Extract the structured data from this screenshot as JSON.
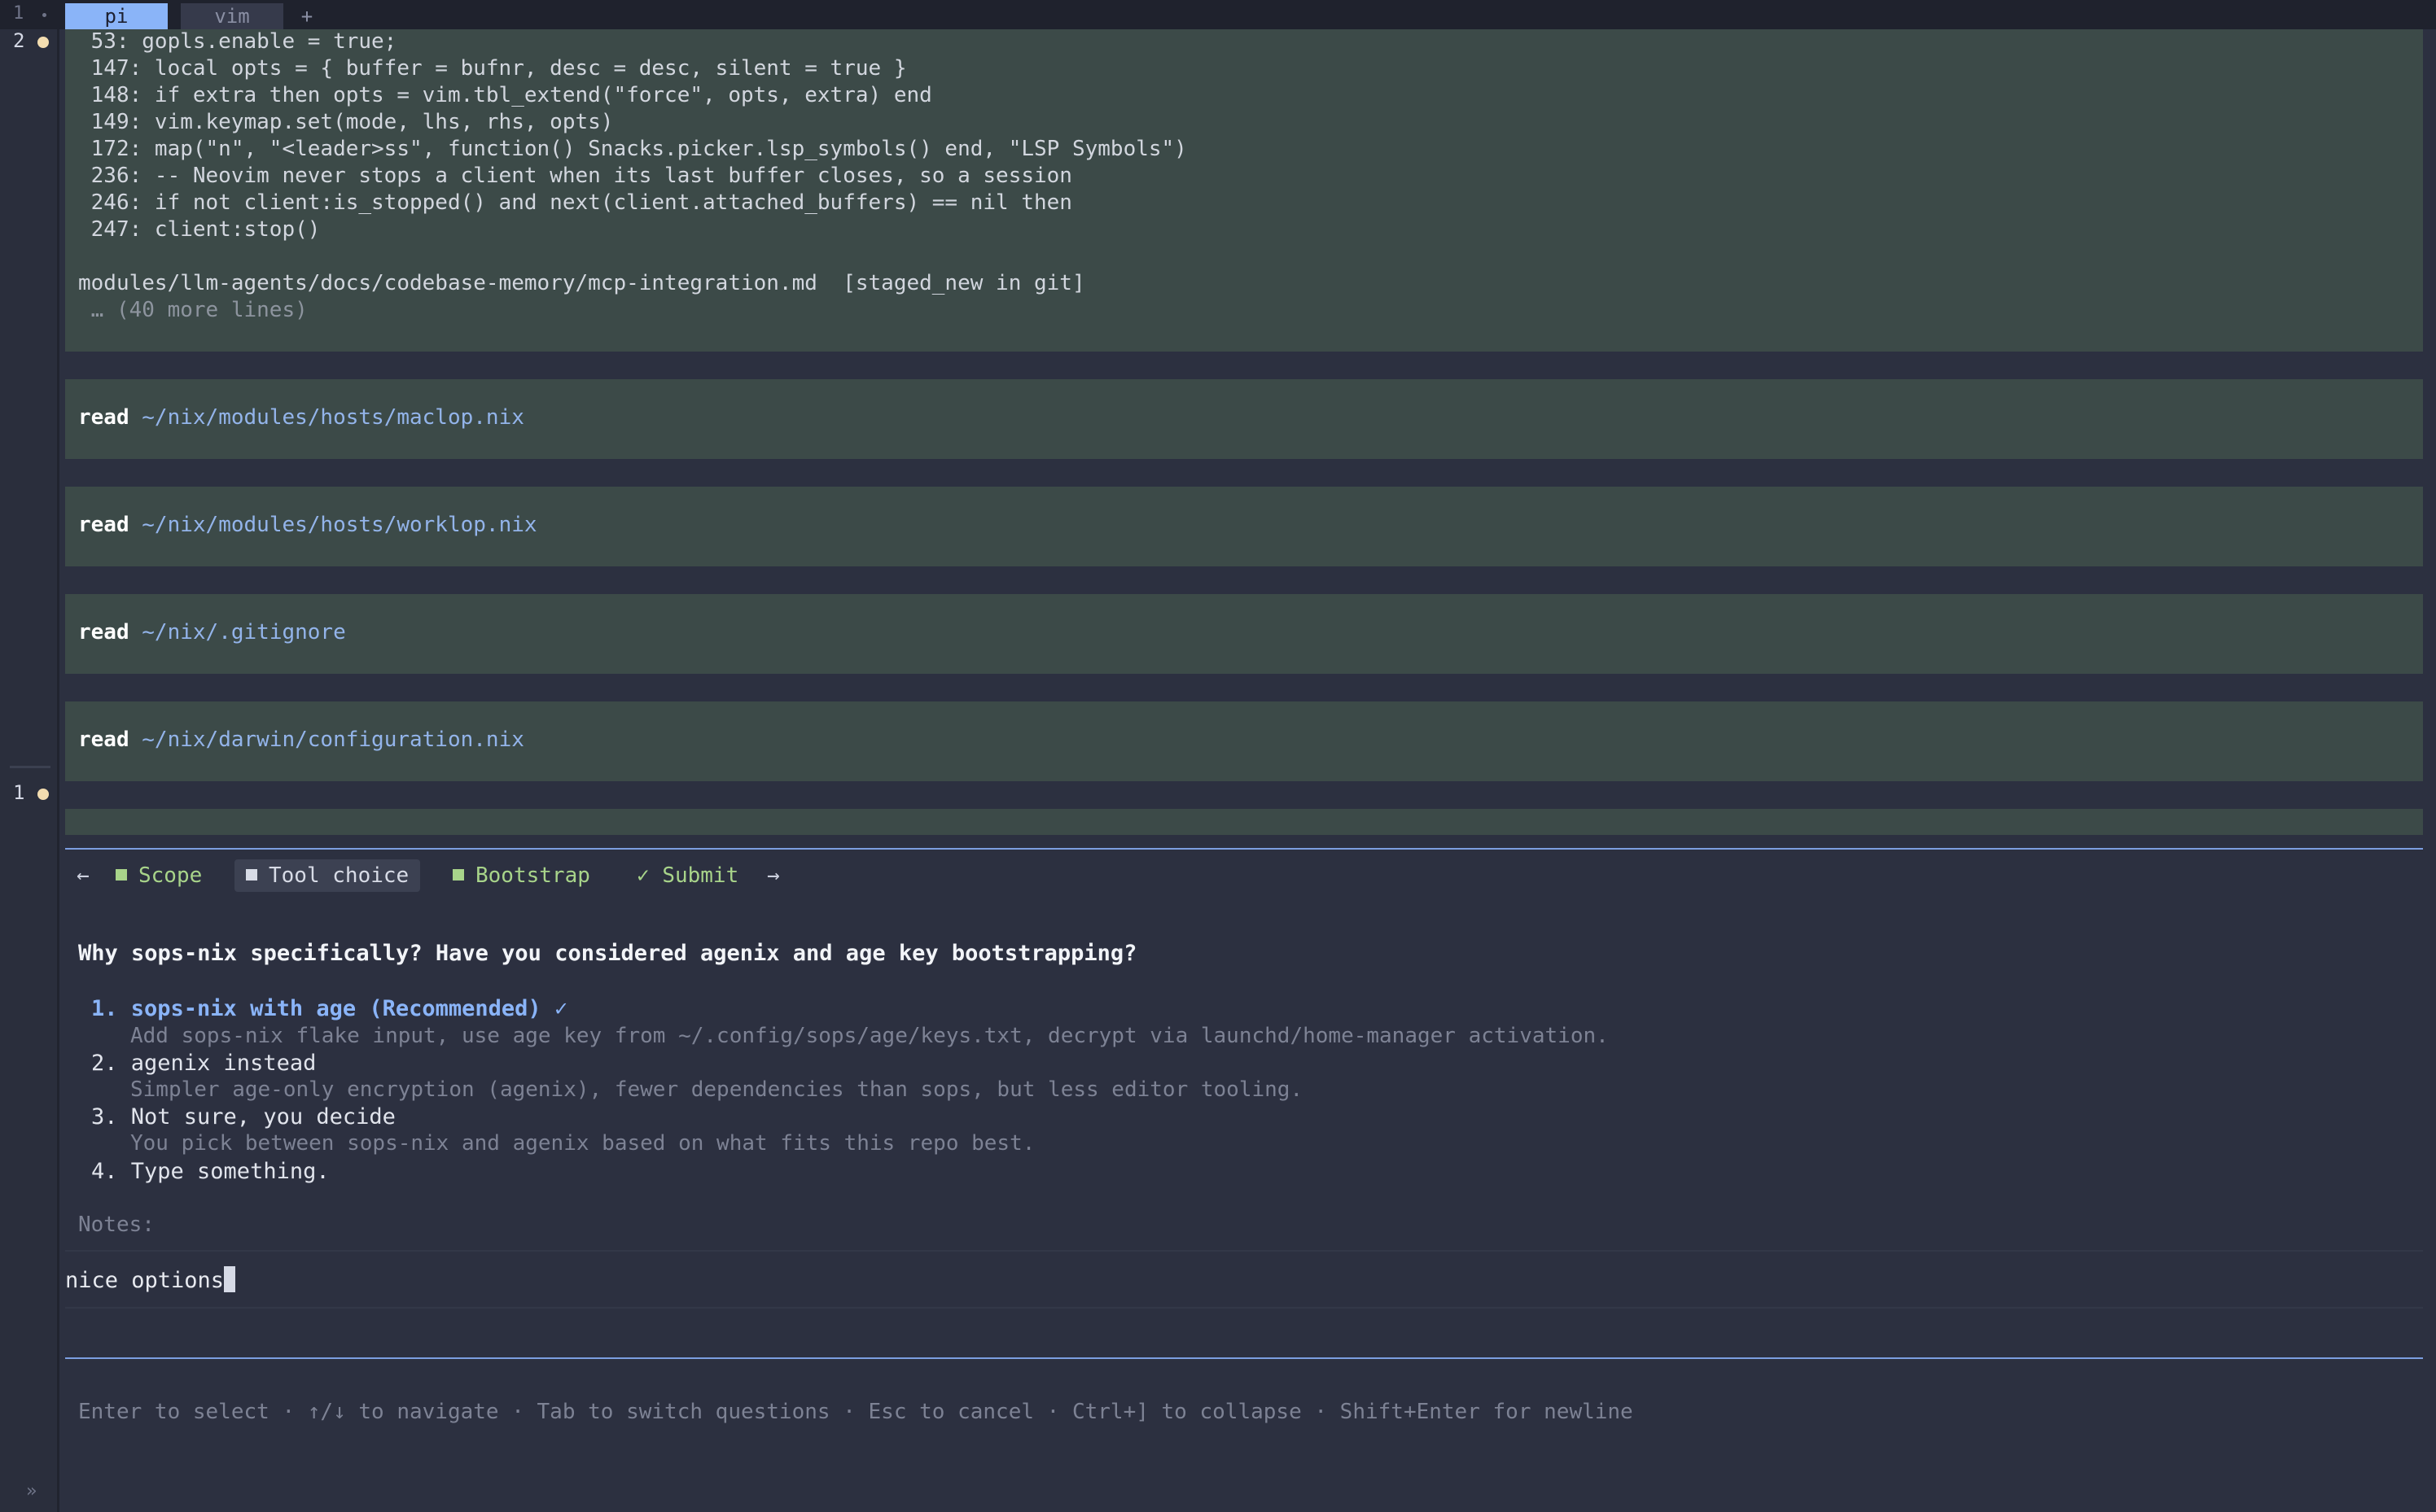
{
  "tabbar": {
    "index": "1",
    "tabs": [
      {
        "label": "pi",
        "active": true
      },
      {
        "label": "vim",
        "active": false
      }
    ],
    "new_tab": "+"
  },
  "gutter": {
    "panes": [
      {
        "number": "2"
      },
      {
        "number": "1"
      }
    ]
  },
  "output": {
    "grep_lines": [
      " 53: gopls.enable = true;",
      " 147: local opts = { buffer = bufnr, desc = desc, silent = true }",
      " 148: if extra then opts = vim.tbl_extend(\"force\", opts, extra) end",
      " 149: vim.keymap.set(mode, lhs, rhs, opts)",
      " 172: map(\"n\", \"<leader>ss\", function() Snacks.picker.lsp_symbols() end, \"LSP Symbols\")",
      " 236: -- Neovim never stops a client when its last buffer closes, so a session",
      " 246: if not client:is_stopped() and next(client.attached_buffers) == nil then",
      " 247: client:stop()"
    ],
    "file_line": "modules/llm-agents/docs/codebase-memory/mcp-integration.md  [staged_new in git]",
    "more_lines": " … (40 more lines)",
    "reads": [
      {
        "keyword": "read",
        "path": "~/nix/modules/hosts/maclop.nix"
      },
      {
        "keyword": "read",
        "path": "~/nix/modules/hosts/worklop.nix"
      },
      {
        "keyword": "read",
        "path": "~/nix/.gitignore"
      },
      {
        "keyword": "read",
        "path": "~/nix/darwin/configuration.nix"
      }
    ]
  },
  "wizard": {
    "prev_arrow": "←",
    "next_arrow": "→",
    "steps": [
      {
        "label": "Scope",
        "state": "done"
      },
      {
        "label": "Tool choice",
        "state": "current"
      },
      {
        "label": "Bootstrap",
        "state": "done"
      },
      {
        "label": "Submit",
        "state": "check",
        "mark": "✓"
      }
    ],
    "question": "Why sops-nix specifically? Have you considered agenix and age key bootstrapping?",
    "options": [
      {
        "label": "1. sops-nix with age (Recommended) ✓",
        "desc": "Add sops-nix flake input, use age key from ~/.config/sops/age/keys.txt, decrypt via launchd/home-manager activation.",
        "selected": true
      },
      {
        "label": "2. agenix instead",
        "desc": "Simpler age-only encryption (agenix), fewer dependencies than sops, but less editor tooling.",
        "selected": false
      },
      {
        "label": "3. Not sure, you decide",
        "desc": "You pick between sops-nix and agenix based on what fits this repo best.",
        "selected": false
      },
      {
        "label": "4. Type something.",
        "desc": "",
        "selected": false
      }
    ],
    "notes_label": "Notes:",
    "notes_value": "nice options",
    "help": "Enter to select · ↑/↓ to navigate · Tab to switch questions · Esc to cancel · Ctrl+] to collapse · Shift+Enter for newline"
  },
  "footer": {
    "chevron": "»"
  },
  "colors": {
    "background": "#2c3040",
    "block": "#3c4a48",
    "accent": "#8ab4f8",
    "done": "#a8d48a",
    "pane_dot": "#f3ddb0"
  }
}
